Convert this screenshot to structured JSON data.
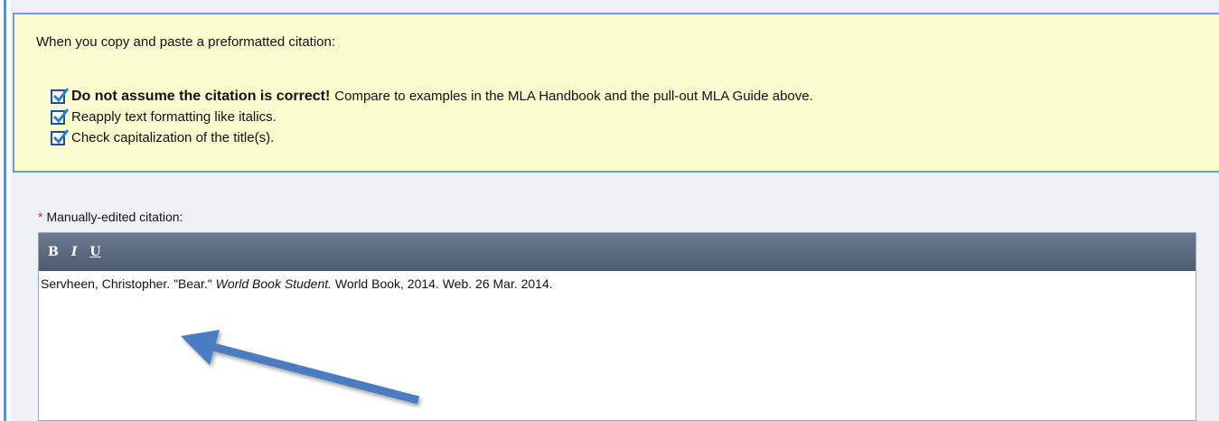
{
  "notice": {
    "intro": "When you copy and paste a preformatted citation:",
    "items": [
      {
        "strong": "Do not assume the citation is correct!",
        "text": "Compare to examples in the MLA Handbook and the pull-out MLA Guide above."
      },
      {
        "strong": "",
        "text": "Reapply text formatting like italics."
      },
      {
        "strong": "",
        "text": "Check capitalization of the title(s)."
      }
    ]
  },
  "field": {
    "required_marker": "*",
    "label": "Manually-edited citation:"
  },
  "editor": {
    "toolbar": {
      "bold": "B",
      "italic": "I",
      "underline": "U"
    },
    "citation_before": "Servheen, Christopher. \"Bear.\"",
    "citation_italic": "World Book Student.",
    "citation_after": "World Book, 2014. Web. 26 Mar. 2014."
  },
  "colors": {
    "notice_bg": "#fbfbd0",
    "notice_border": "#6f9be0",
    "toolbar": "#5a687c",
    "required": "#d42b2b",
    "arrow": "#4a7cc0"
  }
}
